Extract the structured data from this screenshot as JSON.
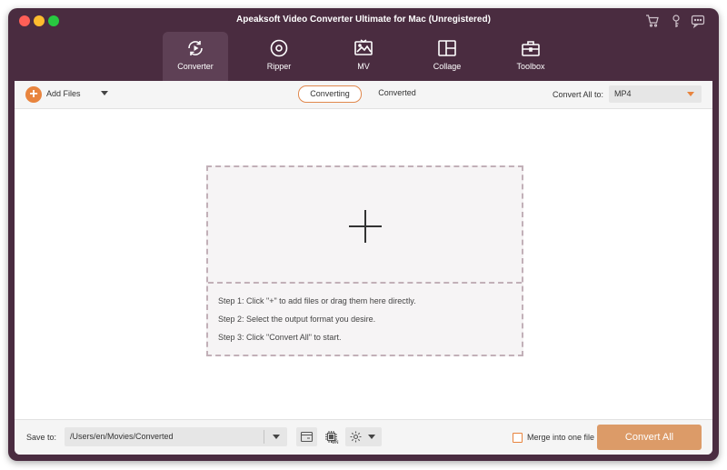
{
  "window": {
    "title": "Apeaksoft Video Converter Ultimate for Mac (Unregistered)",
    "top_icons": [
      "cart-icon",
      "key-icon",
      "chat-icon"
    ]
  },
  "nav_tabs": [
    {
      "label": "Converter",
      "icon": "converter-icon",
      "active": true
    },
    {
      "label": "Ripper",
      "icon": "disc-icon",
      "active": false
    },
    {
      "label": "MV",
      "icon": "mv-icon",
      "active": false
    },
    {
      "label": "Collage",
      "icon": "collage-icon",
      "active": false
    },
    {
      "label": "Toolbox",
      "icon": "toolbox-icon",
      "active": false
    }
  ],
  "toolbar": {
    "add_files_label": "Add Files",
    "subtabs": [
      {
        "label": "Converting",
        "active": true
      },
      {
        "label": "Converted",
        "active": false
      }
    ],
    "convert_all_to_label": "Convert All to:",
    "format_value": "MP4"
  },
  "dropzone": {
    "steps": [
      "Step 1: Click \"+\" to add files or drag them here directly.",
      "Step 2: Select the output format you desire.",
      "Step 3: Click \"Convert All\" to start."
    ]
  },
  "bottom": {
    "save_to_label": "Save to:",
    "path_value": "/Users/en/Movies/Converted",
    "merge_label": "Merge into one file",
    "merge_checked": false,
    "convert_all_button": "Convert All",
    "hw_accel_badge": "ON"
  },
  "colors": {
    "window_bg": "#4a2c40",
    "accent": "#e8843e",
    "convert_button": "#dc9b68"
  }
}
